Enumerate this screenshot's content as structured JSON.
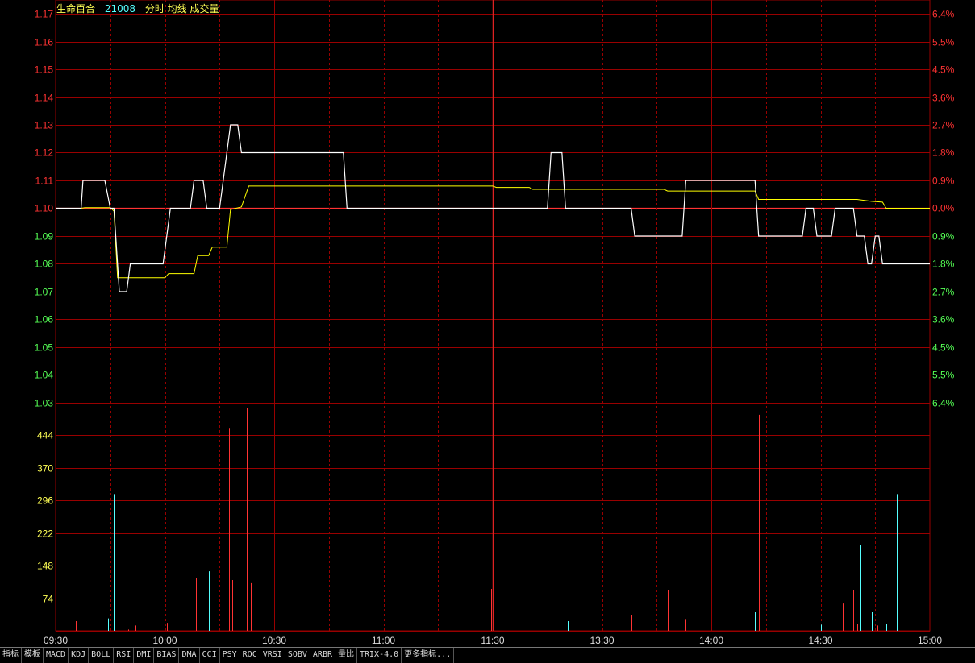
{
  "header": {
    "stock_name": "生命百合",
    "stock_code": "21008",
    "legend_label": "分时 均线 成交量"
  },
  "tabs": [
    "指标",
    "模板",
    "MACD",
    "KDJ",
    "BOLL",
    "RSI",
    "DMI",
    "BIAS",
    "DMA",
    "CCI",
    "PSY",
    "ROC",
    "VRSI",
    "SOBV",
    "ARBR",
    "量比",
    "TRIX-4.0",
    "更多指标..."
  ],
  "chart_data": {
    "type": "line",
    "prev_close": 1.1,
    "price_axis": {
      "ticks": [
        "1.17",
        "1.16",
        "1.15",
        "1.14",
        "1.13",
        "1.12",
        "1.11",
        "1.10",
        "1.09",
        "1.08",
        "1.07",
        "1.06",
        "1.05",
        "1.04",
        "1.03"
      ],
      "ylim": [
        1.03,
        1.17
      ]
    },
    "pct_axis": {
      "ticks": [
        "6.4%",
        "5.5%",
        "4.5%",
        "3.6%",
        "2.7%",
        "1.8%",
        "0.9%",
        "0.0%",
        "0.9%",
        "1.8%",
        "2.7%",
        "3.6%",
        "4.5%",
        "5.5%",
        "6.4%"
      ]
    },
    "volume_axis": {
      "ticks": [
        "444",
        "370",
        "296",
        "222",
        "148",
        "74"
      ],
      "ylim": [
        0,
        444
      ]
    },
    "x_ticks": [
      "09:30",
      "10:00",
      "10:30",
      "11:00",
      "11:30",
      "13:30",
      "14:00",
      "14:30",
      "15:00"
    ],
    "total_minutes": 240,
    "price_series": [
      [
        0,
        1.1
      ],
      [
        7,
        1.1
      ],
      [
        7.5,
        1.11
      ],
      [
        13.5,
        1.11
      ],
      [
        15,
        1.1
      ],
      [
        16,
        1.1
      ],
      [
        17.5,
        1.07
      ],
      [
        19.5,
        1.07
      ],
      [
        20.5,
        1.08
      ],
      [
        29.5,
        1.08
      ],
      [
        30.5,
        1.09
      ],
      [
        31.5,
        1.1
      ],
      [
        37,
        1.1
      ],
      [
        38,
        1.11
      ],
      [
        40.5,
        1.11
      ],
      [
        41.5,
        1.1
      ],
      [
        45,
        1.1
      ],
      [
        47,
        1.12
      ],
      [
        48,
        1.13
      ],
      [
        50,
        1.13
      ],
      [
        51,
        1.12
      ],
      [
        79,
        1.12
      ],
      [
        80,
        1.1
      ],
      [
        135,
        1.1
      ],
      [
        136,
        1.12
      ],
      [
        139,
        1.12
      ],
      [
        140,
        1.1
      ],
      [
        158,
        1.1
      ],
      [
        159,
        1.09
      ],
      [
        172,
        1.09
      ],
      [
        173,
        1.11
      ],
      [
        192,
        1.11
      ],
      [
        193,
        1.09
      ],
      [
        205,
        1.09
      ],
      [
        206,
        1.1
      ],
      [
        208,
        1.1
      ],
      [
        209,
        1.09
      ],
      [
        213,
        1.09
      ],
      [
        214,
        1.1
      ],
      [
        219,
        1.1
      ],
      [
        220,
        1.09
      ],
      [
        222,
        1.09
      ],
      [
        223,
        1.08
      ],
      [
        224,
        1.08
      ],
      [
        225,
        1.09
      ],
      [
        226,
        1.09
      ],
      [
        227,
        1.08
      ],
      [
        240,
        1.08
      ]
    ],
    "avg_series": [
      [
        0,
        1.1
      ],
      [
        7,
        1.1
      ],
      [
        8,
        1.1002
      ],
      [
        15,
        1.1002
      ],
      [
        16,
        1.099
      ],
      [
        17,
        1.075
      ],
      [
        30,
        1.075
      ],
      [
        31,
        1.0765
      ],
      [
        38,
        1.0765
      ],
      [
        39,
        1.083
      ],
      [
        42,
        1.083
      ],
      [
        43,
        1.086
      ],
      [
        47,
        1.086
      ],
      [
        48,
        1.0995
      ],
      [
        51,
        1.1005
      ],
      [
        53,
        1.108
      ],
      [
        120,
        1.108
      ],
      [
        121,
        1.1075
      ],
      [
        130,
        1.1075
      ],
      [
        131,
        1.1068
      ],
      [
        167,
        1.1068
      ],
      [
        168,
        1.1062
      ],
      [
        192,
        1.1062
      ],
      [
        193,
        1.1032
      ],
      [
        220,
        1.1032
      ],
      [
        224,
        1.1025
      ],
      [
        227,
        1.1022
      ],
      [
        228,
        1.1
      ],
      [
        240,
        1.1
      ]
    ],
    "volume_series": [
      {
        "t": 5.5,
        "v": 22,
        "dir": "up"
      },
      {
        "t": 14.5,
        "v": 28,
        "dir": "down"
      },
      {
        "t": 16,
        "v": 310,
        "dir": "down"
      },
      {
        "t": 20,
        "v": 3,
        "dir": "up"
      },
      {
        "t": 22,
        "v": 12,
        "dir": "up"
      },
      {
        "t": 23,
        "v": 15,
        "dir": "up"
      },
      {
        "t": 30.5,
        "v": 18,
        "dir": "up"
      },
      {
        "t": 38.5,
        "v": 120,
        "dir": "up"
      },
      {
        "t": 42,
        "v": 135,
        "dir": "down"
      },
      {
        "t": 47.5,
        "v": 460,
        "dir": "up"
      },
      {
        "t": 48.5,
        "v": 115,
        "dir": "up"
      },
      {
        "t": 52.5,
        "v": 505,
        "dir": "up"
      },
      {
        "t": 53.5,
        "v": 108,
        "dir": "up"
      },
      {
        "t": 119.5,
        "v": 95,
        "dir": "up"
      },
      {
        "t": 130.5,
        "v": 265,
        "dir": "up"
      },
      {
        "t": 135,
        "v": 6,
        "dir": "up"
      },
      {
        "t": 140.5,
        "v": 22,
        "dir": "down"
      },
      {
        "t": 158,
        "v": 35,
        "dir": "up"
      },
      {
        "t": 159,
        "v": 10,
        "dir": "down"
      },
      {
        "t": 168,
        "v": 92,
        "dir": "up"
      },
      {
        "t": 173,
        "v": 25,
        "dir": "up"
      },
      {
        "t": 192,
        "v": 42,
        "dir": "down"
      },
      {
        "t": 193,
        "v": 490,
        "dir": "up"
      },
      {
        "t": 210,
        "v": 14,
        "dir": "down"
      },
      {
        "t": 216,
        "v": 62,
        "dir": "up"
      },
      {
        "t": 219,
        "v": 92,
        "dir": "up"
      },
      {
        "t": 220,
        "v": 15,
        "dir": "up"
      },
      {
        "t": 221,
        "v": 195,
        "dir": "down"
      },
      {
        "t": 222,
        "v": 10,
        "dir": "up"
      },
      {
        "t": 224,
        "v": 42,
        "dir": "down"
      },
      {
        "t": 225.5,
        "v": 12,
        "dir": "up"
      },
      {
        "t": 228,
        "v": 16,
        "dir": "down"
      },
      {
        "t": 231,
        "v": 310,
        "dir": "down"
      }
    ],
    "colors": {
      "price_line": "#ffffff",
      "avg_line": "#ffff00",
      "up": "#ff3333",
      "down": "#55ffff",
      "grid": "#990000",
      "axis_up_text": "#ff3333",
      "axis_down_text": "#55ff55",
      "volume_axis_text": "#ffff55",
      "time_text": "#dddddd",
      "base_line": "#ff3333"
    }
  }
}
